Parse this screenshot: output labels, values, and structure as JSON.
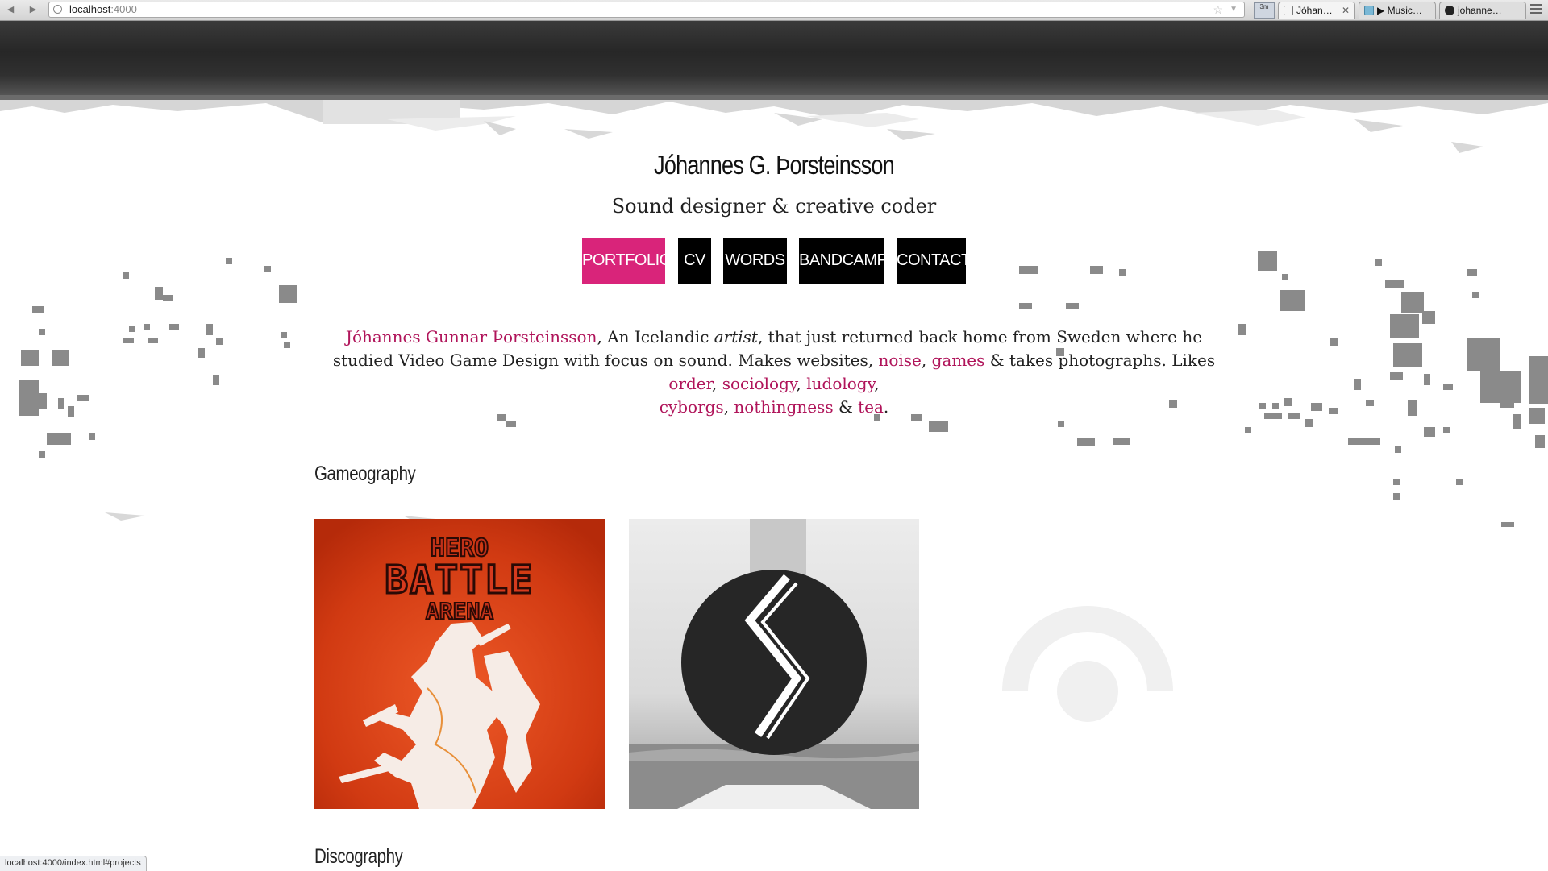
{
  "browser": {
    "url_host": "localhost",
    "url_port": ":4000",
    "ext_badge": "3m",
    "tabs": [
      {
        "label": "Jóhan…",
        "active": true
      },
      {
        "label": "▶ Music…",
        "active": false
      },
      {
        "label": "johanne…",
        "active": false
      }
    ],
    "status_url": "localhost:4000/index.html#projects"
  },
  "site": {
    "title": "Jóhannes G. Þorsteinsson",
    "subtitle": "Sound designer & creative coder",
    "accent_color": "#d9247a",
    "link_color": "#b0145a"
  },
  "nav": {
    "items": [
      {
        "label": "PORTFOLIO",
        "active": true
      },
      {
        "label": "CV",
        "active": false
      },
      {
        "label": "WORDS",
        "active": false
      },
      {
        "label": "BANDCAMP",
        "active": false
      },
      {
        "label": "CONTACT",
        "active": false
      }
    ]
  },
  "bio": {
    "name_link": "Jóhannes Gunnar Þorsteinsson",
    "t1": ", An Icelandic ",
    "t_artist": "artist",
    "t2": ", that just returned back home from Sweden where he studied Video Game Design with focus on sound. Makes websites, ",
    "noise": "noise",
    "sep1": ", ",
    "games": "games",
    "t3": " & takes photographs. Likes ",
    "order": "order",
    "sep2": ", ",
    "sociology": "sociology",
    "sep3": ", ",
    "ludology": "ludology",
    "sep4": ", ",
    "cyborgs": "cyborgs",
    "sep5": ", ",
    "nothingness": "nothingness",
    "t4": " & ",
    "tea": "tea",
    "t5": "."
  },
  "sections": {
    "games_heading": "Gameography",
    "disco_heading": "Discography"
  },
  "games": [
    {
      "title_line1": "HERO",
      "title_line2": "BATTLE",
      "title_line3": "ARENA",
      "icon": "hero-battle-arena-cover"
    },
    {
      "icon": "rune-logo-cover"
    }
  ]
}
